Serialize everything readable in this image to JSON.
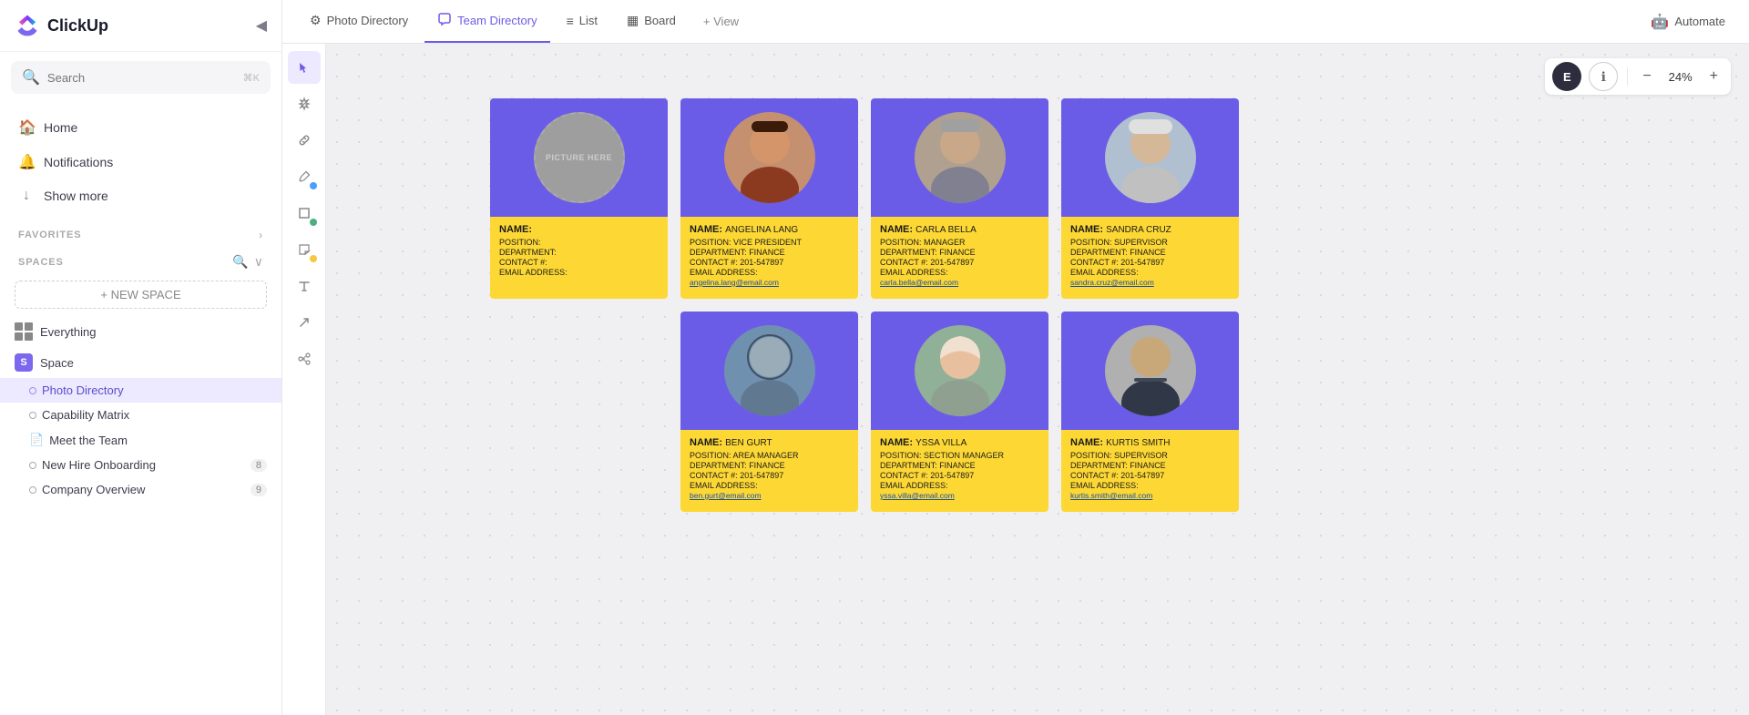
{
  "app": {
    "name": "ClickUp"
  },
  "sidebar": {
    "collapse_label": "◀",
    "search_placeholder": "Search",
    "search_shortcut": "⌘K",
    "nav": [
      {
        "id": "home",
        "label": "Home",
        "icon": "🏠"
      },
      {
        "id": "notifications",
        "label": "Notifications",
        "icon": "🔔"
      },
      {
        "id": "show-more",
        "label": "Show more",
        "icon": "↓"
      }
    ],
    "favorites_label": "FAVORITES",
    "spaces_label": "SPACES",
    "new_space_label": "+ NEW SPACE",
    "spaces": [
      {
        "id": "everything",
        "label": "Everything",
        "icon": "grid"
      },
      {
        "id": "space",
        "label": "Space",
        "icon": "S"
      }
    ],
    "tree_items": [
      {
        "id": "photo-directory",
        "label": "Photo Directory",
        "active": true,
        "icon": "dot-purple"
      },
      {
        "id": "capability-matrix",
        "label": "Capability Matrix",
        "active": false,
        "icon": "dot"
      },
      {
        "id": "meet-the-team",
        "label": "Meet the Team",
        "active": false,
        "icon": "doc"
      },
      {
        "id": "new-hire-onboarding",
        "label": "New Hire Onboarding",
        "active": false,
        "icon": "dot",
        "badge": "8"
      },
      {
        "id": "company-overview",
        "label": "Company Overview",
        "active": false,
        "icon": "dot",
        "badge": "9"
      }
    ]
  },
  "tabs": [
    {
      "id": "photo-directory",
      "label": "Photo Directory",
      "icon": "⚙",
      "active": false
    },
    {
      "id": "team-directory",
      "label": "Team Directory",
      "icon": "🔗",
      "active": true
    },
    {
      "id": "list",
      "label": "List",
      "icon": "≡",
      "active": false
    },
    {
      "id": "board",
      "label": "Board",
      "icon": "▦",
      "active": false
    },
    {
      "id": "add-view",
      "label": "+ View",
      "active": false
    }
  ],
  "automate_label": "Automate",
  "zoom": {
    "value": "24%",
    "minus_label": "−",
    "plus_label": "+"
  },
  "user_avatar": "E",
  "toolbar_tools": [
    {
      "id": "cursor",
      "icon": "▶",
      "active": true
    },
    {
      "id": "magic",
      "icon": "✦",
      "dot": "none"
    },
    {
      "id": "link",
      "icon": "🔗",
      "dot": "none"
    },
    {
      "id": "pencil",
      "icon": "✏",
      "dot": "blue"
    },
    {
      "id": "rect",
      "icon": "□",
      "dot": "green"
    },
    {
      "id": "sticky",
      "icon": "🗒",
      "dot": "yellow"
    },
    {
      "id": "text",
      "icon": "T",
      "dot": "none"
    },
    {
      "id": "arrow",
      "icon": "↗",
      "dot": "none"
    },
    {
      "id": "connect",
      "icon": "⚯",
      "dot": "none"
    }
  ],
  "template_card": {
    "circle_label": "PICTURE HERE",
    "name_label": "NAME:",
    "fields": [
      {
        "key": "POSITION:",
        "value": ""
      },
      {
        "key": "DEPARTMENT:",
        "value": ""
      },
      {
        "key": "CONTACT #:",
        "value": ""
      },
      {
        "key": "EMAIL ADDRESS:",
        "value": ""
      }
    ]
  },
  "people_cards": [
    {
      "id": "angelina-lang",
      "name_label": "NAME:",
      "name": "ANGELINA LANG",
      "position": "VICE PRESIDENT",
      "department": "FINANCE",
      "contact": "201-547897",
      "email": "angelina.lang@email.com",
      "photo_color": "#c8956a"
    },
    {
      "id": "carla-bella",
      "name_label": "NAME:",
      "name": "CARLA BELLA",
      "position": "MANAGER",
      "department": "FINANCE",
      "contact": "201-547897",
      "email": "carla.bella@email.com",
      "photo_color": "#c0a080"
    },
    {
      "id": "sandra-cruz",
      "name_label": "NAME:",
      "name": "SANDRA CRUZ",
      "position": "SUPERVISOR",
      "department": "FINANCE",
      "contact": "201-547897",
      "email": "sandra.cruz@email.com",
      "photo_color": "#d4a47a"
    },
    {
      "id": "ben-gurt",
      "name_label": "NAME:",
      "name": "BEN GURT",
      "position": "AREA MANAGER",
      "department": "FINANCE",
      "contact": "201-547897",
      "email": "ben.gurt@email.com",
      "photo_color": "#8090a0"
    },
    {
      "id": "yssa-villa",
      "name_label": "NAME:",
      "name": "YSSA VILLA",
      "position": "SECTION MANAGER",
      "department": "FINANCE",
      "contact": "201-547897",
      "email": "yssa.villa@email.com",
      "photo_color": "#d4b090"
    },
    {
      "id": "kurtis-smith",
      "name_label": "NAME:",
      "name": "KURTIS SMITH",
      "position": "SUPERVISOR",
      "department": "FINANCE",
      "contact": "201-547897",
      "email": "kurtis.smith@email.com",
      "photo_color": "#b09070"
    }
  ]
}
